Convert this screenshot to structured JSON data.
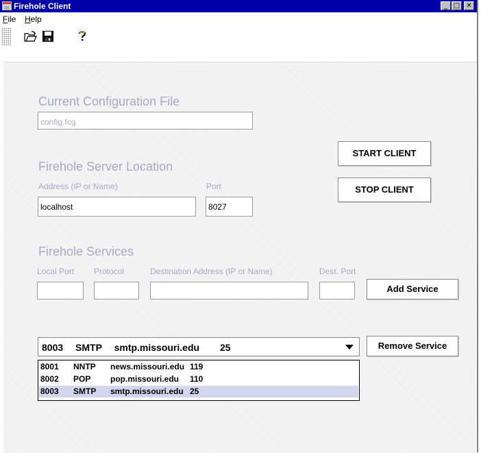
{
  "window": {
    "title": "Firehole Client",
    "minimize": "_",
    "maximize": "□",
    "close": "✕"
  },
  "menu": [
    "File",
    "Help"
  ],
  "toolbar": {
    "icons": [
      "open-folder-icon",
      "save-disk-icon",
      "help-icon"
    ]
  },
  "config": {
    "heading": "Current Configuration File",
    "file_value": "config.fcg"
  },
  "server": {
    "heading": "Firehole Server Location",
    "address_label": "Address (IP or Name)",
    "address_value": "localhost",
    "port_label": "Port",
    "port_value": "8027"
  },
  "buttons": {
    "start": "START CLIENT",
    "stop": "STOP CLIENT",
    "add_service": "Add Service",
    "remove_service": "Remove Service"
  },
  "services": {
    "heading": "Firehole Services",
    "columns": [
      "Local Port",
      "Protocol",
      "Destination Address (IP or Name)",
      "Dest. Port"
    ],
    "selected": {
      "port": "8003",
      "protocol": "SMTP",
      "host": "smtp.missouri.edu",
      "dest": "25"
    },
    "items": [
      {
        "port": "8001",
        "protocol": "NNTP",
        "host": "news.missouri.edu",
        "dest": "119"
      },
      {
        "port": "8002",
        "protocol": "POP",
        "host": "pop.missouri.edu",
        "dest": "110"
      },
      {
        "port": "8003",
        "protocol": "SMTP",
        "host": "smtp.missouri.edu",
        "dest": "25"
      }
    ]
  }
}
